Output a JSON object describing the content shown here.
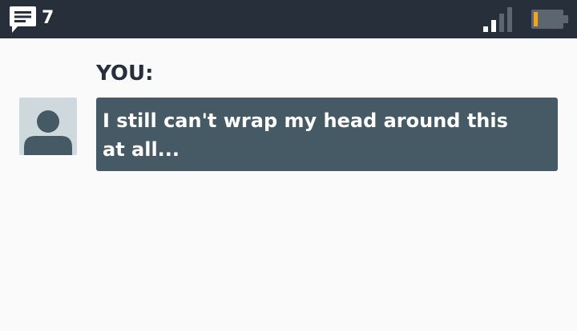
{
  "status_bar": {
    "message_icon": "message-icon",
    "message_count": "7",
    "signal_icon": "signal-icon",
    "battery_icon": "battery-icon",
    "battery_level": 0.15,
    "colors": {
      "background": "#27303a",
      "battery_fill": "#f5a31a",
      "icon": "#ffffff"
    }
  },
  "conversation": {
    "sender": "YOU:",
    "avatar_icon": "avatar-icon",
    "message": "I still can't wrap my head around this at all...",
    "colors": {
      "bubble": "#455a64",
      "avatar_bg": "#cfd8dc",
      "avatar_figure": "#455a64"
    }
  }
}
